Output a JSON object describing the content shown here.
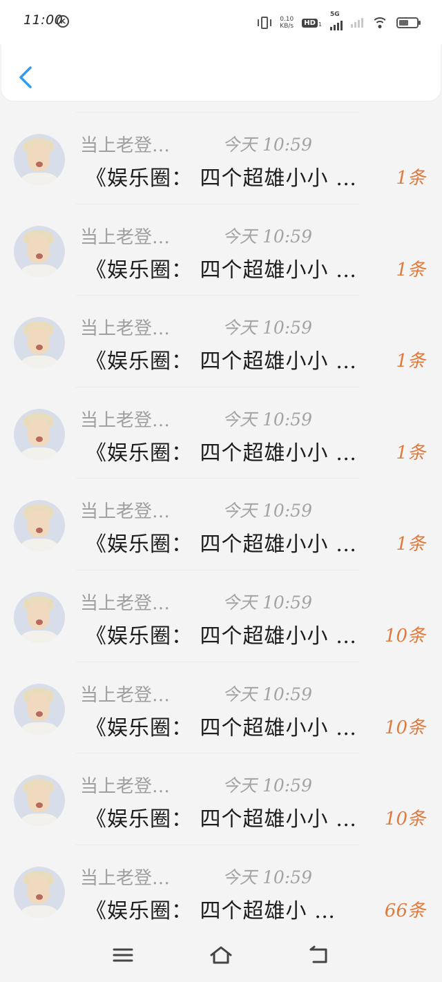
{
  "status_bar": {
    "time": "11:00",
    "k_badge": "K",
    "net_speed_value": "0.10",
    "net_speed_unit": "KB/s",
    "hd_label": "HD",
    "hd_sub": "1",
    "network_label": "5G",
    "battery_level": 0.55
  },
  "nav": {
    "back_icon": "chevron-left-icon",
    "accent_color": "#2f9bf0"
  },
  "items": [
    {
      "sender": "当上老登…",
      "time": "今天 10:59",
      "message": "《娱乐圈： 四个超雄小小 …",
      "count": "1条"
    },
    {
      "sender": "当上老登…",
      "time": "今天 10:59",
      "message": "《娱乐圈： 四个超雄小小 …",
      "count": "1条"
    },
    {
      "sender": "当上老登…",
      "time": "今天 10:59",
      "message": "《娱乐圈： 四个超雄小小 …",
      "count": "1条"
    },
    {
      "sender": "当上老登…",
      "time": "今天 10:59",
      "message": "《娱乐圈： 四个超雄小小 …",
      "count": "1条"
    },
    {
      "sender": "当上老登…",
      "time": "今天 10:59",
      "message": "《娱乐圈： 四个超雄小小 …",
      "count": "1条"
    },
    {
      "sender": "当上老登…",
      "time": "今天 10:59",
      "message": "《娱乐圈： 四个超雄小小 …",
      "count": "10条"
    },
    {
      "sender": "当上老登…",
      "time": "今天 10:59",
      "message": "《娱乐圈： 四个超雄小小 …",
      "count": "10条"
    },
    {
      "sender": "当上老登…",
      "time": "今天 10:59",
      "message": "《娱乐圈： 四个超雄小小 …",
      "count": "10条"
    },
    {
      "sender": "当上老登…",
      "time": "今天 10:59",
      "message": "《娱乐圈： 四个超雄小 …",
      "count": "66条"
    }
  ],
  "colors": {
    "count_color": "#e07a3c",
    "sender_color": "#9f9f9f",
    "message_color": "#1c1c1c"
  },
  "bottom_nav": {
    "menu_icon": "menu-icon",
    "home_icon": "home-icon",
    "return_icon": "return-icon"
  }
}
